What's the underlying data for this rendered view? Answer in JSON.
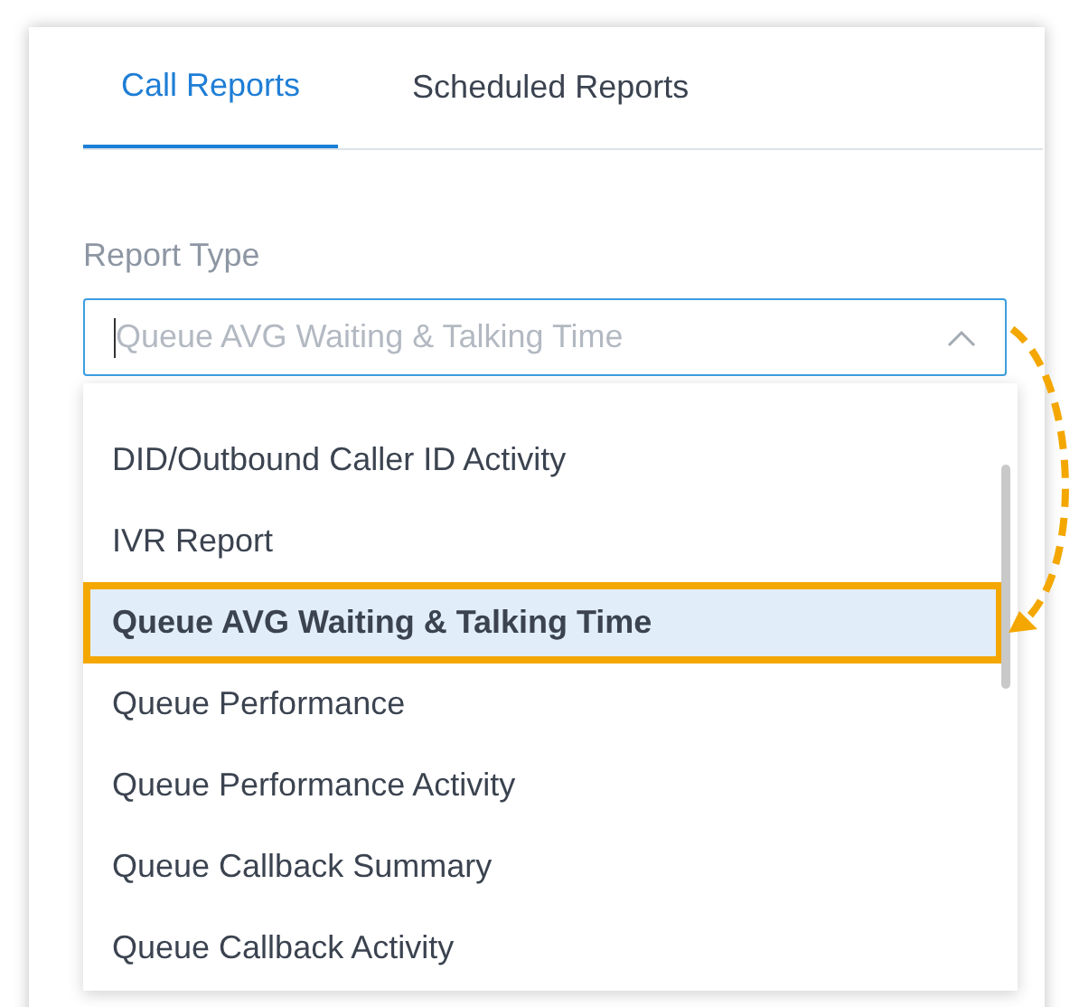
{
  "tabs": [
    {
      "label": "Call Reports",
      "selected": true
    },
    {
      "label": "Scheduled Reports",
      "selected": false
    }
  ],
  "report_type": {
    "label": "Report Type",
    "placeholder": "Queue AVG Waiting & Talking Time",
    "expanded": true
  },
  "options": [
    {
      "label": "DID/Outbound Caller ID Activity",
      "selected": false
    },
    {
      "label": "IVR Report",
      "selected": false
    },
    {
      "label": "Queue AVG Waiting & Talking Time",
      "selected": true
    },
    {
      "label": "Queue Performance",
      "selected": false
    },
    {
      "label": "Queue Performance Activity",
      "selected": false
    },
    {
      "label": "Queue Callback Summary",
      "selected": false
    },
    {
      "label": "Queue Callback Activity",
      "selected": false
    }
  ]
}
